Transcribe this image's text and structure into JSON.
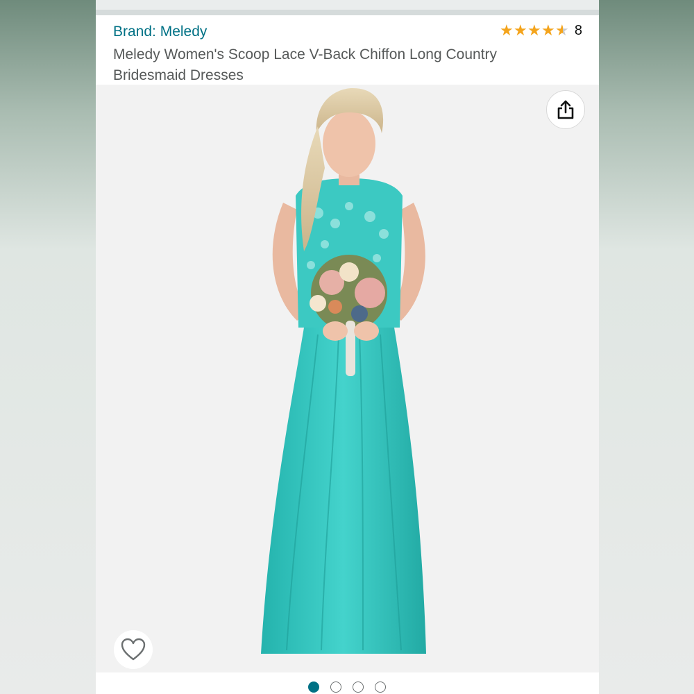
{
  "product": {
    "brand": "Brand: Meledy",
    "title": "Meledy Women's Scoop Lace V-Back Chiffon Long Country Bridesmaid Dresses",
    "rating_value": 4.5,
    "rating_count": "8"
  },
  "image": {
    "alt": "Woman in turquoise chiffon gown holding a bouquet",
    "carousel_total": 4,
    "carousel_active": 1
  },
  "icons": {
    "share": "share-icon",
    "wishlist": "heart-icon"
  },
  "colors": {
    "link": "#007185",
    "star": "#f4a41c",
    "dress": "#2fc7c0"
  }
}
